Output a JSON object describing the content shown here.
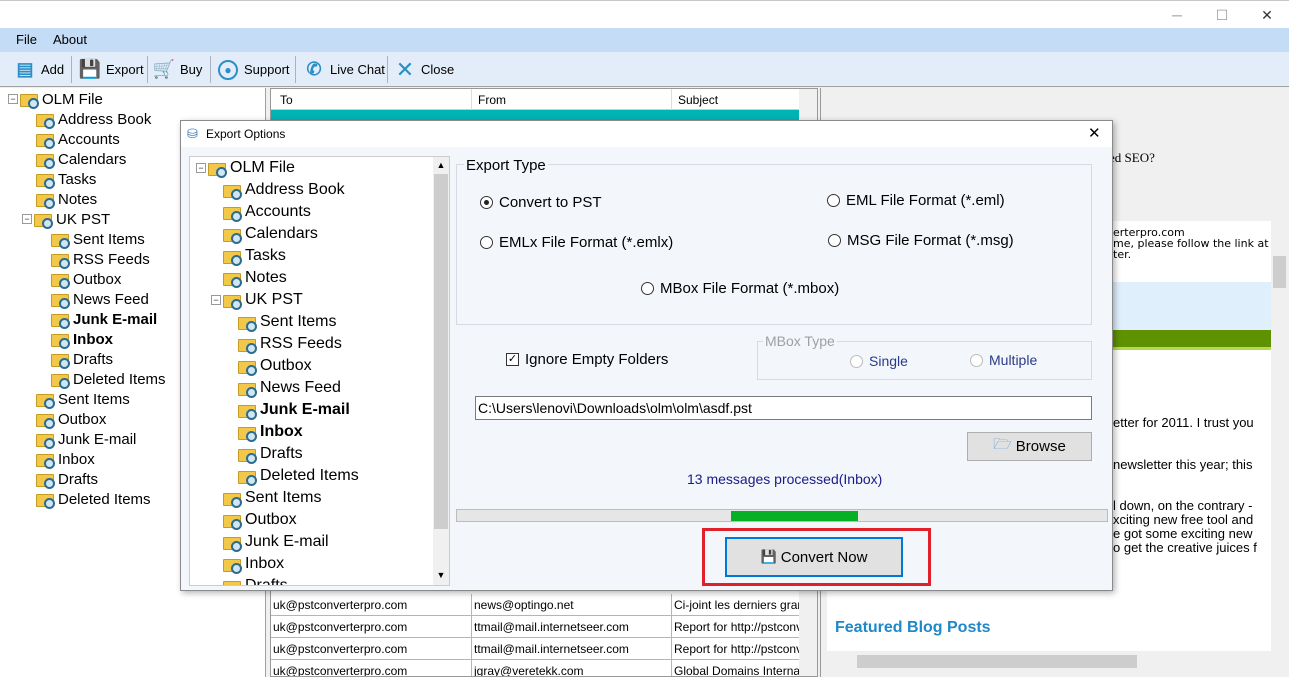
{
  "window": {
    "minimize": "─",
    "maximize": "☐",
    "close": "✕"
  },
  "menu": [
    "File",
    "About"
  ],
  "toolbar": [
    {
      "label": "Add",
      "icon": "add-file-icon"
    },
    {
      "label": "Export",
      "icon": "floppy-icon"
    },
    {
      "label": "Buy",
      "icon": "cart-icon"
    },
    {
      "label": "Support",
      "icon": "user-support-icon"
    },
    {
      "label": "Live Chat",
      "icon": "phone-icon"
    },
    {
      "label": "Close",
      "icon": "close-x-icon"
    }
  ],
  "tree": {
    "root": "OLM File",
    "items": [
      "Address Book",
      "Accounts",
      "Calendars",
      "Tasks",
      "Notes"
    ],
    "pst": "UK PST",
    "pst_items": [
      "Sent Items",
      "RSS Feeds",
      "Outbox",
      "News Feed",
      "Junk E-mail",
      "Inbox",
      "Drafts",
      "Deleted Items"
    ],
    "after": [
      "Sent Items",
      "Outbox",
      "Junk E-mail",
      "Inbox",
      "Drafts",
      "Deleted Items"
    ]
  },
  "mail": {
    "headers": [
      "To",
      "From",
      "Subject"
    ],
    "rows": [
      [
        "uk@pstconverterpro.com",
        "news@optingo.net",
        "Ci-joint les derniers grands"
      ],
      [
        "uk@pstconverterpro.com",
        "ttmail@mail.internetseer.com",
        "Report for http://pstconve"
      ],
      [
        "uk@pstconverterpro.com",
        "ttmail@mail.internetseer.com",
        "Report for http://pstconve"
      ],
      [
        "uk@pstconverterpro.com",
        "jgray@veretekk.com",
        "Global Domains Internation"
      ]
    ]
  },
  "preview": {
    "heading_fragment": "nged SEO?",
    "lines": [
      "erterpro.com",
      "me, please follow the link at",
      "ter."
    ],
    "body": [
      "etter for 2011. I trust you",
      "newsletter this year; this",
      "l down, on the contrary -",
      "xciting new free tool and",
      "e got some exciting new",
      "o get the creative juices f"
    ],
    "featured": "Featured Blog Posts",
    "band_color": "#5f9200"
  },
  "dialog": {
    "title": "Export Options",
    "close": "✕",
    "tree_after": [
      "Sent Items",
      "Outbox",
      "Junk E-mail",
      "Inbox",
      "Drafts"
    ],
    "export_type": "Export Type",
    "options": {
      "pst": "Convert to PST",
      "eml": "EML File  Format (*.eml)",
      "emlx": "EMLx File  Format (*.emlx)",
      "msg": "MSG File Format (*.msg)",
      "mbox": "MBox File Format (*.mbox)"
    },
    "selected": "pst",
    "ignore_empty": "Ignore Empty Folders",
    "ignore_checked": true,
    "mbox_type": "MBox Type",
    "single": "Single",
    "multiple": "Multiple",
    "path": "C:\\Users\\lenovi\\Downloads\\olm\\olm\\asdf.pst",
    "browse": "Browse",
    "status": "13 messages processed(Inbox)",
    "convert": "Convert Now",
    "highlight_color": "#e0202a"
  }
}
